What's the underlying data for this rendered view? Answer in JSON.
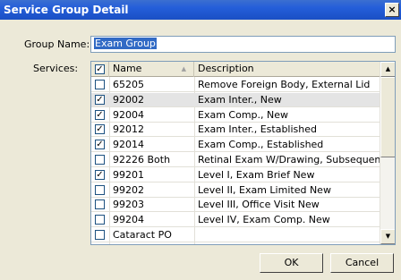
{
  "window": {
    "title": "Service Group Detail",
    "close_glyph": "×"
  },
  "form": {
    "group_name_label": "Group Name:",
    "group_name_value": "Exam Group",
    "services_label": "Services:"
  },
  "grid": {
    "columns": [
      "Name",
      "Description"
    ],
    "header_checked": true,
    "rows": [
      {
        "checked": false,
        "name": "65205",
        "description": "Remove Foreign Body, External Lid"
      },
      {
        "checked": true,
        "name": "92002",
        "description": "Exam Inter., New",
        "selected": true
      },
      {
        "checked": true,
        "name": "92004",
        "description": "Exam Comp., New"
      },
      {
        "checked": true,
        "name": "92012",
        "description": "Exam Inter., Established"
      },
      {
        "checked": true,
        "name": "92014",
        "description": "Exam Comp., Established"
      },
      {
        "checked": false,
        "name": "92226 Both",
        "description": "Retinal Exam W/Drawing, Subsequen"
      },
      {
        "checked": true,
        "name": "99201",
        "description": "Level I, Exam Brief New"
      },
      {
        "checked": false,
        "name": "99202",
        "description": "Level II, Exam Limited New"
      },
      {
        "checked": false,
        "name": "99203",
        "description": "Level III, Office Visit New"
      },
      {
        "checked": false,
        "name": "99204",
        "description": "Level IV, Exam Comp. New"
      },
      {
        "checked": false,
        "name": "Cataract PO",
        "description": ""
      }
    ]
  },
  "buttons": {
    "ok": "OK",
    "cancel": "Cancel"
  },
  "icons": {
    "sort": "sort-ascending-icon",
    "scroll_up": "scroll-up-icon",
    "scroll_down": "scroll-down-icon"
  }
}
